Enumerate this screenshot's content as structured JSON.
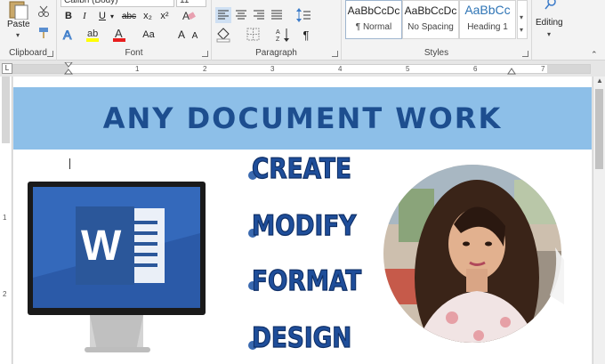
{
  "clipboard": {
    "paste_label": "Paste",
    "group_label": "Clipboard"
  },
  "font": {
    "font_name": "Calibri (Body)",
    "font_size": "11",
    "bold": "B",
    "italic": "I",
    "underline": "U",
    "strike": "abc",
    "subscript": "x₂",
    "superscript": "x²",
    "change_case": "Aa",
    "grow": "A",
    "shrink": "A",
    "group_label": "Font"
  },
  "paragraph": {
    "group_label": "Paragraph"
  },
  "styles": {
    "items": [
      {
        "sample": "AaBbCcDc",
        "name": "¶ Normal"
      },
      {
        "sample": "AaBbCcDc",
        "name": "No Spacing"
      },
      {
        "sample": "AaBbCc",
        "name": "Heading 1"
      }
    ],
    "group_label": "Styles"
  },
  "editing": {
    "label": "Editing"
  },
  "ruler": {
    "numbers": [
      "1",
      "2",
      "3",
      "4",
      "5",
      "6",
      "7"
    ]
  },
  "document": {
    "banner": "ANY DOCUMENT WORK",
    "services": [
      "CREATE",
      "MODIFY",
      "FORMAT",
      "DESIGN"
    ],
    "word_logo_letter": "W"
  },
  "colors": {
    "banner_bg": "#8dbfe8",
    "banner_text": "#1d4e8f",
    "service_text": "#1f4e9a",
    "word_blue": "#2b579a"
  }
}
